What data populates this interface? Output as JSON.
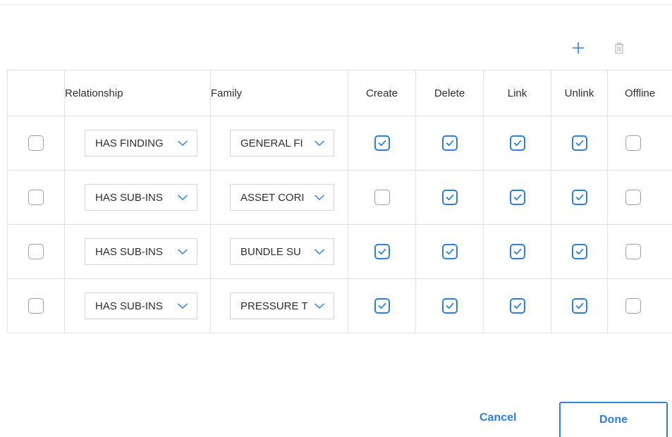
{
  "toolbar": {
    "add_icon": "plus-icon",
    "delete_icon": "trash-icon",
    "accent_color": "#2f7fd8",
    "disabled_color": "#b8bec4"
  },
  "table": {
    "headers": {
      "relationship": "Relationship",
      "family": "Family",
      "create": "Create",
      "delete": "Delete",
      "link": "Link",
      "unlink": "Unlink",
      "offline": "Offline"
    },
    "rows": [
      {
        "selected": false,
        "relationship": "HAS FINDING",
        "family": "GENERAL FI",
        "create": true,
        "delete": true,
        "link": true,
        "unlink": true,
        "offline": false
      },
      {
        "selected": false,
        "relationship": "HAS SUB-INS",
        "family": "ASSET CORI",
        "create": false,
        "delete": true,
        "link": true,
        "unlink": true,
        "offline": false
      },
      {
        "selected": false,
        "relationship": "HAS SUB-INS",
        "family": "BUNDLE SU",
        "create": true,
        "delete": true,
        "link": true,
        "unlink": true,
        "offline": false
      },
      {
        "selected": false,
        "relationship": "HAS SUB-INS",
        "family": "PRESSURE T",
        "create": true,
        "delete": true,
        "link": true,
        "unlink": true,
        "offline": false
      }
    ]
  },
  "footer": {
    "cancel_label": "Cancel",
    "done_label": "Done"
  }
}
